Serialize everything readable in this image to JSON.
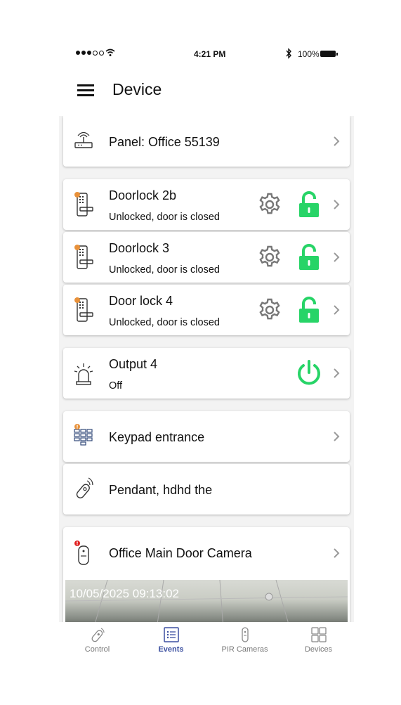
{
  "status_bar": {
    "time": "4:21 PM",
    "battery": "100%"
  },
  "header": {
    "title": "Device"
  },
  "devices": [
    {
      "name": "Panel: Office 55139",
      "icon": "router-icon"
    },
    {
      "name": "Doorlock 2b",
      "status": "Unlocked, door is closed",
      "icon": "doorlock-icon"
    },
    {
      "name": "Doorlock 3",
      "status": "Unlocked, door is closed",
      "icon": "doorlock-icon"
    },
    {
      "name": "Door lock 4",
      "status": "Unlocked, door is closed",
      "icon": "doorlock-icon"
    },
    {
      "name": "Output 4",
      "status": "Off",
      "icon": "siren-icon"
    },
    {
      "name": "Keypad entrance",
      "icon": "keypad-icon"
    },
    {
      "name": "Pendant, hdhd the",
      "icon": "pendant-icon"
    },
    {
      "name": "Office Main Door Camera",
      "icon": "pir-camera-icon",
      "timestamp": "10/05/2025 09:13:02"
    }
  ],
  "colors": {
    "accent_green": "#27d467",
    "nav_active": "#3b4fa0",
    "warning_orange": "#e8913a",
    "alert_red": "#e02020"
  },
  "bottom_nav": [
    {
      "label": "Control",
      "icon": "remote-icon"
    },
    {
      "label": "Events",
      "icon": "events-list-icon",
      "active": true
    },
    {
      "label": "PIR Cameras",
      "icon": "pir-camera-icon"
    },
    {
      "label": "Devices",
      "icon": "grid-icon"
    }
  ]
}
